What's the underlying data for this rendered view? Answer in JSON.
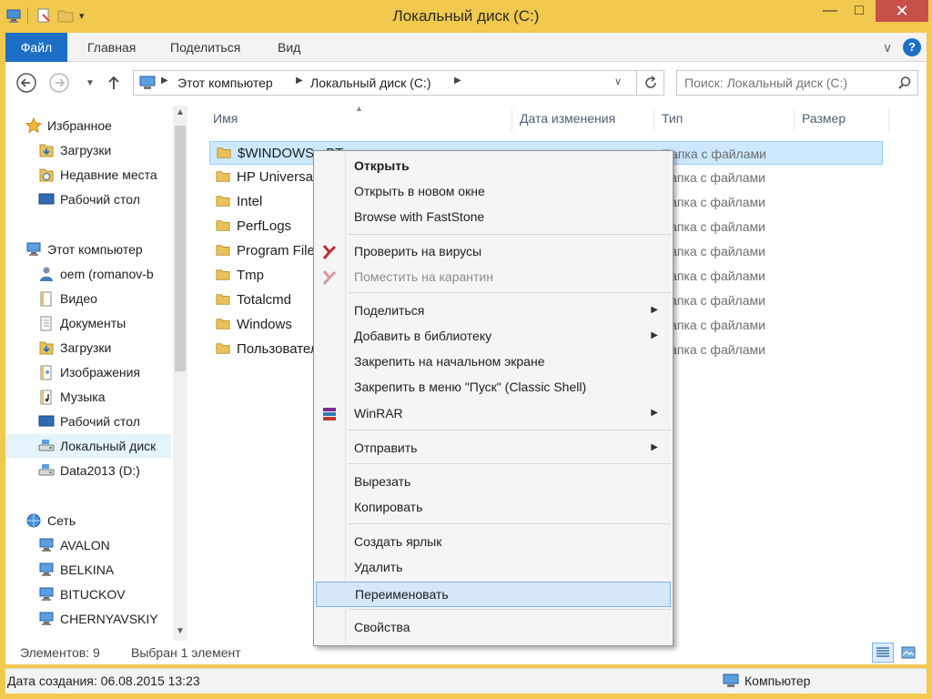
{
  "window": {
    "title": "Локальный диск (C:)",
    "minimize_glyph": "—",
    "maximize_glyph": "□",
    "close_glyph": "✕"
  },
  "ribbon": {
    "tabs": [
      "Файл",
      "Главная",
      "Поделиться",
      "Вид"
    ],
    "expand_glyph": "∨",
    "help_glyph": "?"
  },
  "nav": {
    "breadcrumb": [
      "Этот компьютер",
      "Локальный диск (C:)"
    ],
    "search_placeholder": "Поиск: Локальный диск (C:)"
  },
  "sidebar": {
    "items": [
      {
        "label": "Избранное",
        "icon": "star-icon"
      },
      {
        "label": "Загрузки",
        "icon": "downloads-icon"
      },
      {
        "label": "Недавние места",
        "icon": "recent-icon"
      },
      {
        "label": "Рабочий стол",
        "icon": "desktop-icon"
      },
      {
        "label": "Этот компьютер",
        "icon": "computer-icon"
      },
      {
        "label": "oem (romanov-b",
        "icon": "user-icon"
      },
      {
        "label": "Видео",
        "icon": "video-icon"
      },
      {
        "label": "Документы",
        "icon": "documents-icon"
      },
      {
        "label": "Загрузки",
        "icon": "downloads-icon"
      },
      {
        "label": "Изображения",
        "icon": "pictures-icon"
      },
      {
        "label": "Музыка",
        "icon": "music-icon"
      },
      {
        "label": "Рабочий стол",
        "icon": "desktop-icon"
      },
      {
        "label": "Локальный диск",
        "icon": "drive-icon"
      },
      {
        "label": "Data2013 (D:)",
        "icon": "drive-icon"
      },
      {
        "label": "Сеть",
        "icon": "network-icon"
      },
      {
        "label": "AVALON",
        "icon": "computer-icon"
      },
      {
        "label": "BELKINA",
        "icon": "computer-icon"
      },
      {
        "label": "BITUCKOV",
        "icon": "computer-icon"
      },
      {
        "label": "CHERNYAVSKIY",
        "icon": "computer-icon"
      }
    ]
  },
  "filelist": {
    "columns": [
      "Имя",
      "Дата изменения",
      "Тип",
      "Размер"
    ],
    "rows": [
      {
        "name": "$WINDOWS.~BT",
        "type": "Папка с файлами"
      },
      {
        "name": "HP Universal",
        "type": "Папка с файлами"
      },
      {
        "name": "Intel",
        "type": "Папка с файлами"
      },
      {
        "name": "PerfLogs",
        "type": "Папка с файлами"
      },
      {
        "name": "Program Files",
        "type": "Папка с файлами"
      },
      {
        "name": "Tmp",
        "type": "Папка с файлами"
      },
      {
        "name": "Totalcmd",
        "type": "Папка с файлами"
      },
      {
        "name": "Windows",
        "type": "Папка с файлами"
      },
      {
        "name": "Пользователи",
        "type": "Папка с файлами"
      }
    ]
  },
  "context_menu": {
    "items": [
      {
        "label": "Открыть",
        "bold": true
      },
      {
        "label": "Открыть в новом окне"
      },
      {
        "label": "Browse with FastStone"
      },
      {
        "label": "Проверить на вирусы",
        "icon": "kaspersky-icon"
      },
      {
        "label": "Поместить на карантин",
        "icon": "kaspersky-icon",
        "disabled": true
      },
      {
        "label": "Поделиться",
        "submenu": true
      },
      {
        "label": "Добавить в библиотеку",
        "submenu": true
      },
      {
        "label": "Закрепить на начальном экране"
      },
      {
        "label": "Закрепить в меню \"Пуск\" (Classic Shell)"
      },
      {
        "label": "WinRAR",
        "icon": "winrar-icon",
        "submenu": true
      },
      {
        "label": "Отправить",
        "submenu": true
      },
      {
        "label": "Вырезать"
      },
      {
        "label": "Копировать"
      },
      {
        "label": "Создать ярлык"
      },
      {
        "label": "Удалить"
      },
      {
        "label": "Переименовать",
        "highlighted": true
      },
      {
        "label": "Свойства"
      }
    ],
    "submenu_glyph": "▶"
  },
  "status": {
    "count": "Элементов: 9",
    "selected": "Выбран 1 элемент"
  },
  "details": {
    "created": "Дата создания: 06.08.2015 13:23",
    "location": "Компьютер"
  }
}
